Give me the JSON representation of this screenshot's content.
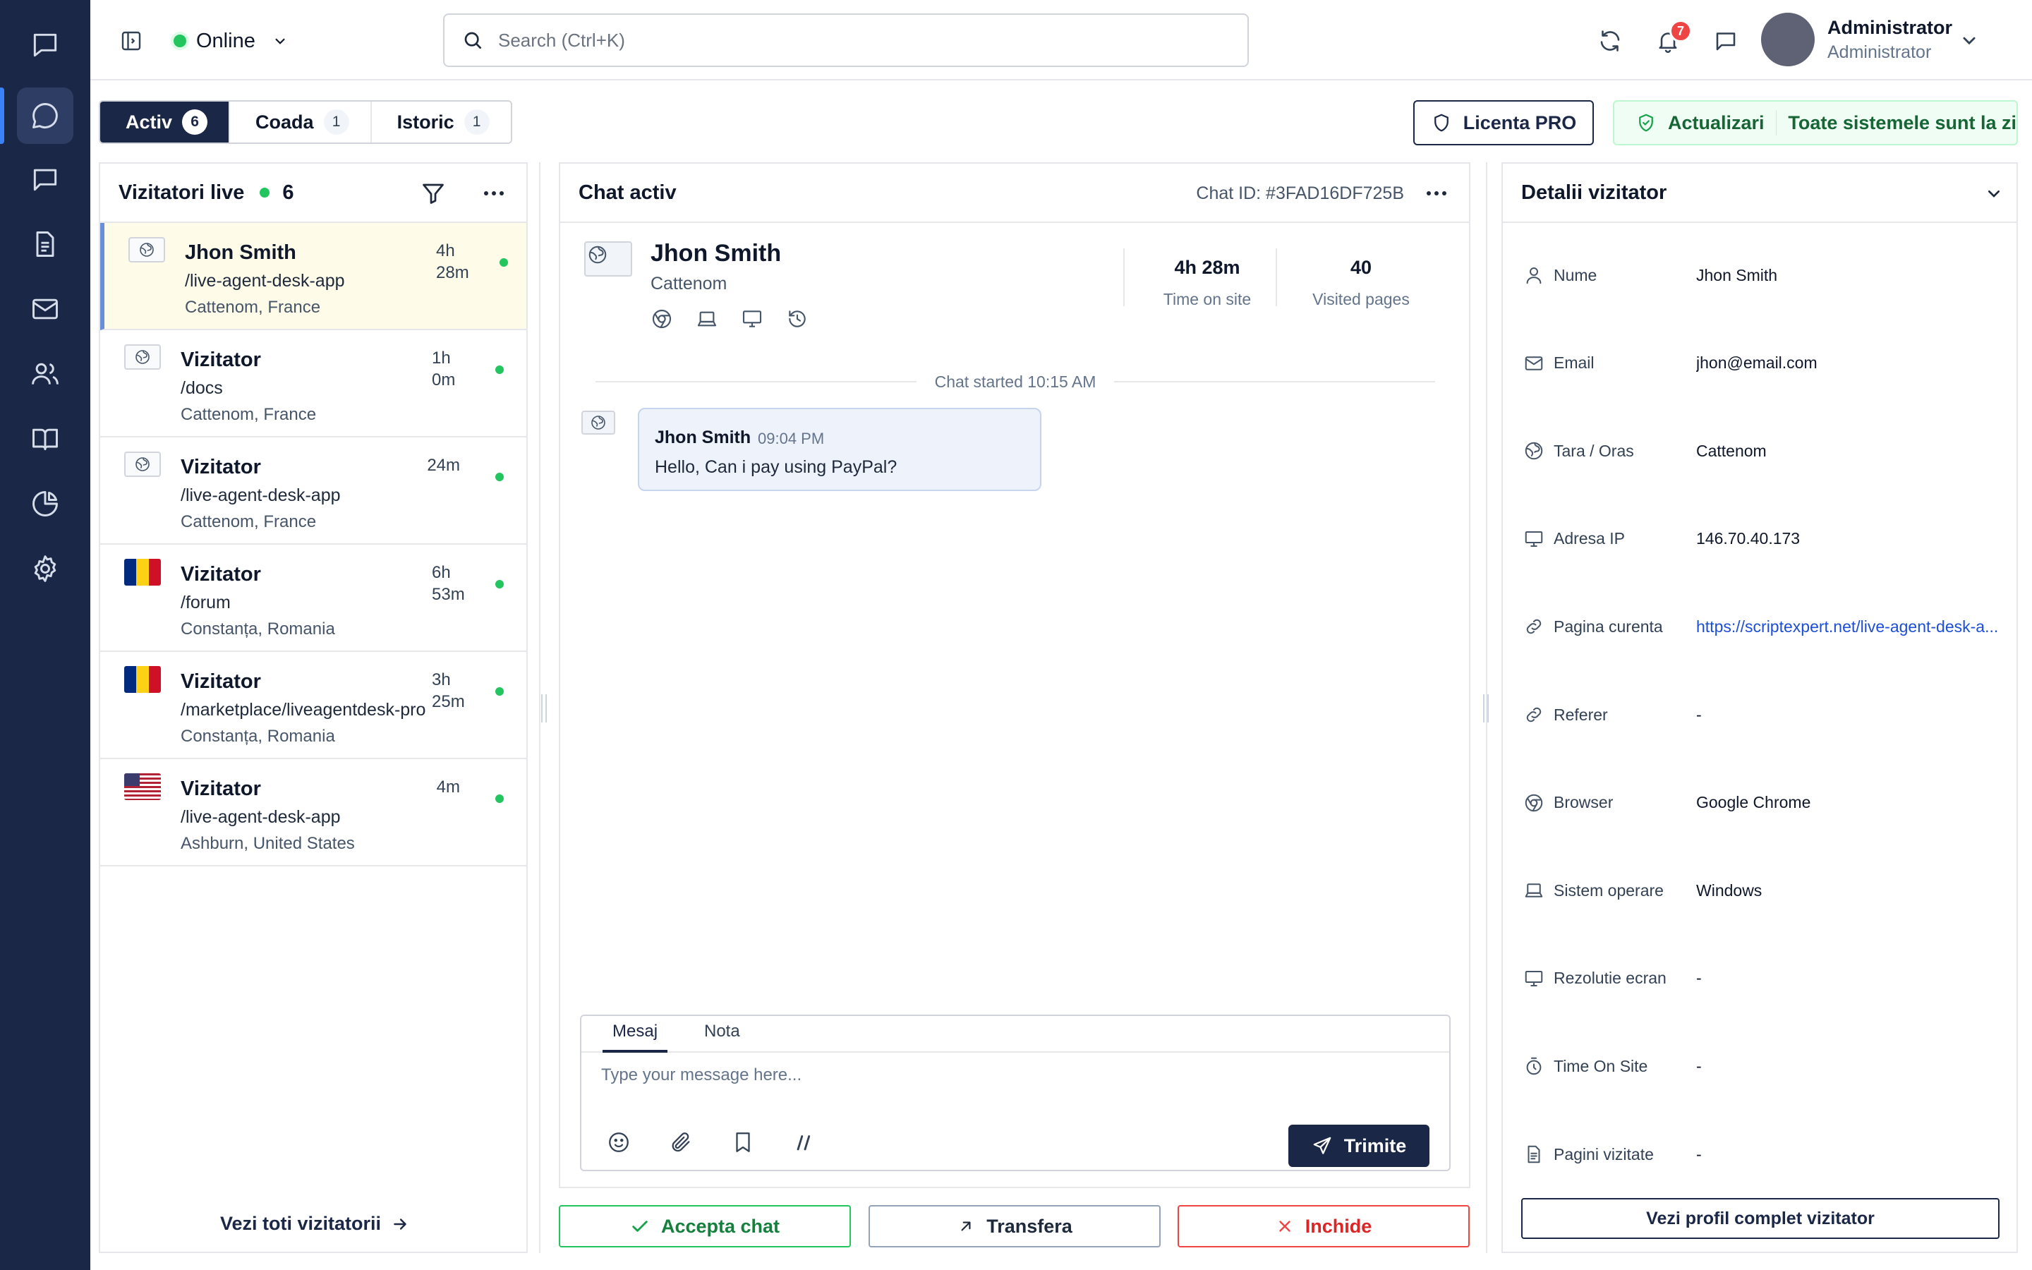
{
  "topbar": {
    "status": "Online",
    "search_placeholder": "Search (Ctrl+K)",
    "notifications_count": "7",
    "user_name": "Administrator",
    "user_role": "Administrator"
  },
  "tabs": [
    {
      "label": "Activ",
      "count": "6"
    },
    {
      "label": "Coada",
      "count": "1"
    },
    {
      "label": "Istoric",
      "count": "1"
    }
  ],
  "license_label": "Licenta PRO",
  "updates": {
    "label": "Actualizari",
    "status": "Toate sistemele sunt la zi"
  },
  "visitors": {
    "title": "Vizitatori live",
    "count": "6",
    "see_all": "Vezi toti vizitatorii",
    "items": [
      {
        "name": "Jhon Smith",
        "path": "/live-agent-desk-app",
        "location": "Cattenom, France",
        "time": "4h 28m",
        "flag": "globe-icon"
      },
      {
        "name": "Vizitator",
        "path": "/docs",
        "location": "Cattenom, France",
        "time": "1h 0m",
        "flag": "globe-icon"
      },
      {
        "name": "Vizitator",
        "path": "/live-agent-desk-app",
        "location": "Cattenom, France",
        "time": "24m",
        "flag": "globe-icon"
      },
      {
        "name": "Vizitator",
        "path": "/forum",
        "location": "Constanța, Romania",
        "time": "6h 53m",
        "flag": "romania-flag"
      },
      {
        "name": "Vizitator",
        "path": "/marketplace/liveagentdesk-pro",
        "location": "Constanța, Romania",
        "time": "3h 25m",
        "flag": "romania-flag"
      },
      {
        "name": "Vizitator",
        "path": "/live-agent-desk-app",
        "location": "Ashburn, United States",
        "time": "4m",
        "flag": "usa-flag"
      }
    ]
  },
  "chat": {
    "title": "Chat activ",
    "chat_id": "Chat ID: #3FAD16DF725B",
    "visitor_name": "Jhon Smith",
    "visitor_city": "Cattenom",
    "time_on_site": "4h 28m",
    "time_on_site_label": "Time on site",
    "visited_pages": "40",
    "visited_pages_label": "Visited pages",
    "started": "Chat started 10:15 AM",
    "messages": [
      {
        "author": "Jhon Smith",
        "time": "09:04 PM",
        "text": "Hello, Can i pay using PayPal?"
      }
    ],
    "composer": {
      "tab_message": "Mesaj",
      "tab_note": "Nota",
      "placeholder": "Type your message here...",
      "send_label": "Trimite"
    },
    "actions": {
      "accept": "Accepta chat",
      "transfer": "Transfera",
      "close": "Inchide"
    }
  },
  "details": {
    "title": "Detalii vizitator",
    "rows": [
      {
        "label": "Nume",
        "value": "Jhon Smith",
        "icon": "user-icon"
      },
      {
        "label": "Email",
        "value": "jhon@email.com",
        "icon": "mail-icon"
      },
      {
        "label": "Tara / Oras",
        "value": "Cattenom",
        "icon": "globe-icon"
      },
      {
        "label": "Adresa IP",
        "value": "146.70.40.173",
        "icon": "monitor-icon"
      },
      {
        "label": "Pagina curenta",
        "value": "https://scriptexpert.net/live-agent-desk-a...",
        "icon": "link-icon"
      },
      {
        "label": "Referer",
        "value": "-",
        "icon": "link-icon"
      },
      {
        "label": "Browser",
        "value": "Google Chrome",
        "icon": "chrome-icon"
      },
      {
        "label": "Sistem operare",
        "value": "Windows",
        "icon": "laptop-icon"
      },
      {
        "label": "Rezolutie ecran",
        "value": "-",
        "icon": "monitor-icon"
      },
      {
        "label": "Time On Site",
        "value": "-",
        "icon": "timer-icon"
      },
      {
        "label": "Pagini vizitate",
        "value": "-",
        "icon": "file-icon"
      }
    ],
    "profile_button": "Vezi profil complet vizitator"
  }
}
